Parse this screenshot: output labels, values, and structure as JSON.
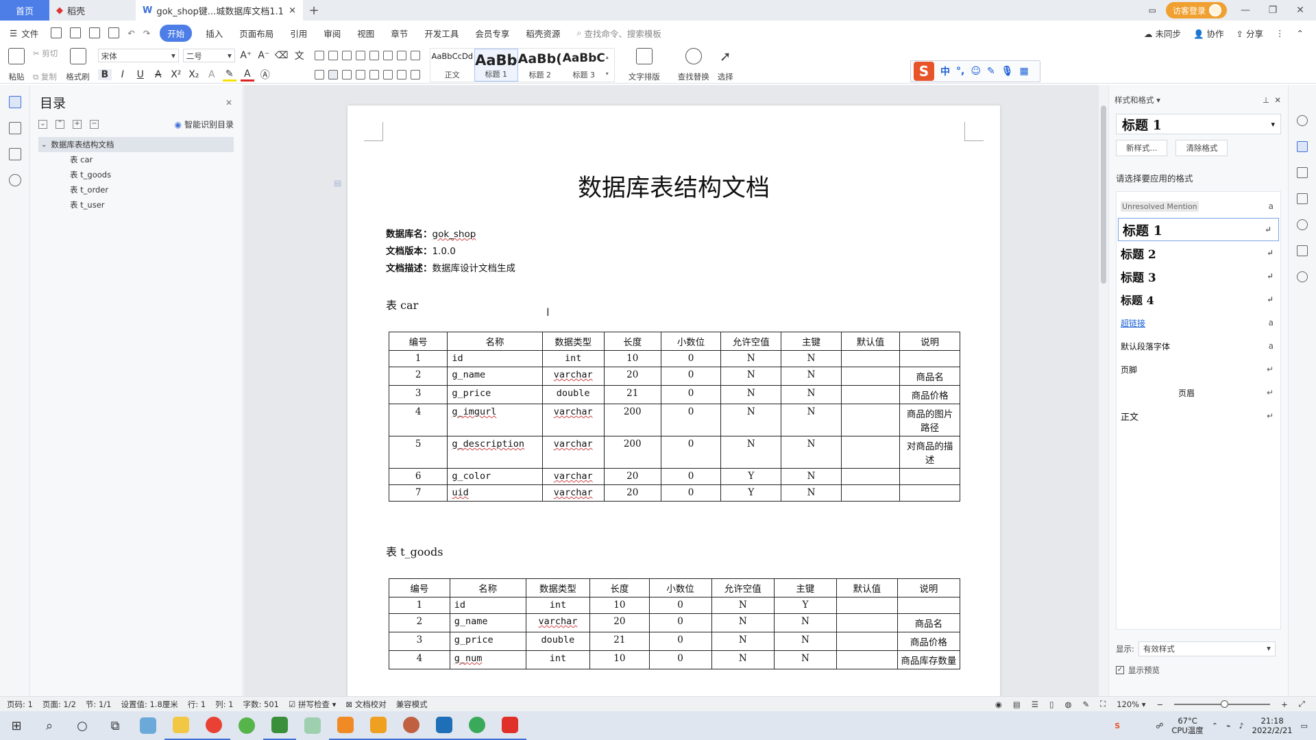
{
  "tabs": {
    "home": "首页",
    "daoke": "稻壳",
    "doc": "gok_shop键...城数据库文档1.1",
    "add": "+"
  },
  "titlebar": {
    "guest_login": "访客登录"
  },
  "menu": {
    "file": "文件",
    "items": [
      "开始",
      "插入",
      "页面布局",
      "引用",
      "审阅",
      "视图",
      "章节",
      "开发工具",
      "会员专享",
      "稻壳资源"
    ],
    "search": "查找命令、搜索模板",
    "right": [
      "未同步",
      "协作",
      "分享"
    ]
  },
  "ribbon": {
    "paste": "粘贴",
    "cut": "剪切",
    "copy": "复制",
    "format_painter": "格式刷",
    "font": "宋体",
    "size": "二号",
    "styles": [
      {
        "preview": "AaBbCcDd",
        "label": "正文"
      },
      {
        "preview": "AaBb",
        "label": "标题 1"
      },
      {
        "preview": "AaBb(",
        "label": "标题 2"
      },
      {
        "preview": "AaBbC",
        "label": "标题 3"
      }
    ],
    "text_layout": "文字排版",
    "find_replace": "查找替换",
    "select": "选择"
  },
  "ime": {
    "logo": "S",
    "lang": "中"
  },
  "outline": {
    "title": "目录",
    "smart": "智能识别目录",
    "root": "数据库表结构文档",
    "children": [
      "表 car",
      "表 t_goods",
      "表 t_order",
      "表 t_user"
    ]
  },
  "document": {
    "title": "数据库表结构文档",
    "meta": [
      {
        "label": "数据库名：",
        "value": "gok_shop"
      },
      {
        "label": "文档版本：",
        "value": "1.0.0"
      },
      {
        "label": "文档描述：",
        "value": "数据库设计文档生成"
      }
    ],
    "headers": [
      "编号",
      "名称",
      "数据类型",
      "长度",
      "小数位",
      "允许空值",
      "主键",
      "默认值",
      "说明"
    ],
    "tables": [
      {
        "heading": "表 car",
        "rows": [
          [
            "1",
            "id",
            "int",
            "10",
            "0",
            "N",
            "N",
            "",
            ""
          ],
          [
            "2",
            "g_name",
            "varchar",
            "20",
            "0",
            "N",
            "N",
            "",
            "商品名"
          ],
          [
            "3",
            "g_price",
            "double",
            "21",
            "0",
            "N",
            "N",
            "",
            "商品价格"
          ],
          [
            "4",
            "g_imgurl",
            "varchar",
            "200",
            "0",
            "N",
            "N",
            "",
            "商品的图片路径"
          ],
          [
            "5",
            "g_description",
            "varchar",
            "200",
            "0",
            "N",
            "N",
            "",
            "对商品的描述"
          ],
          [
            "6",
            "g_color",
            "varchar",
            "20",
            "0",
            "Y",
            "N",
            "",
            ""
          ],
          [
            "7",
            "uid",
            "varchar",
            "20",
            "0",
            "Y",
            "N",
            "",
            ""
          ]
        ]
      },
      {
        "heading": "表 t_goods",
        "rows": [
          [
            "1",
            "id",
            "int",
            "10",
            "0",
            "N",
            "Y",
            "",
            ""
          ],
          [
            "2",
            "g_name",
            "varchar",
            "20",
            "0",
            "N",
            "N",
            "",
            "商品名"
          ],
          [
            "3",
            "g_price",
            "double",
            "21",
            "0",
            "N",
            "N",
            "",
            "商品价格"
          ],
          [
            "4",
            "g_num",
            "int",
            "10",
            "0",
            "N",
            "N",
            "",
            "商品库存数量"
          ]
        ]
      }
    ]
  },
  "stylepane": {
    "title": "样式和格式",
    "current": "标题  1",
    "new_style": "新样式...",
    "clear_format": "清除格式",
    "prompt": "请选择要应用的格式",
    "items": [
      {
        "name": "Unresolved Mention",
        "mark": "a"
      },
      {
        "name": "标题  1",
        "mark": "↵"
      },
      {
        "name": "标题  2",
        "mark": "↵"
      },
      {
        "name": "标题  3",
        "mark": "↵"
      },
      {
        "name": "标题  4",
        "mark": "↵"
      },
      {
        "name": "超链接",
        "mark": "a"
      },
      {
        "name": "默认段落字体",
        "mark": "a"
      },
      {
        "name": "页脚",
        "mark": "↵"
      },
      {
        "name": "页眉",
        "mark": "↵"
      },
      {
        "name": "正文",
        "mark": "↵"
      }
    ],
    "show_label": "显示:",
    "show_value": "有效样式",
    "preview_label": "显示预览"
  },
  "status": {
    "items": [
      "页码: 1",
      "页面: 1/2",
      "节: 1/1",
      "设置值: 1.8厘米",
      "行: 1",
      "列: 1",
      "字数: 501",
      "拼写检查",
      "文档校对",
      "兼容模式"
    ],
    "zoom": "120%"
  },
  "taskbar": {
    "temp": "67°C",
    "temp_label": "CPU温度",
    "time": "21:18",
    "date": "2022/2/21"
  },
  "colors": {
    "accent": "#4d7ee8",
    "guest": "#f0a030",
    "ime": "#e8542a"
  }
}
